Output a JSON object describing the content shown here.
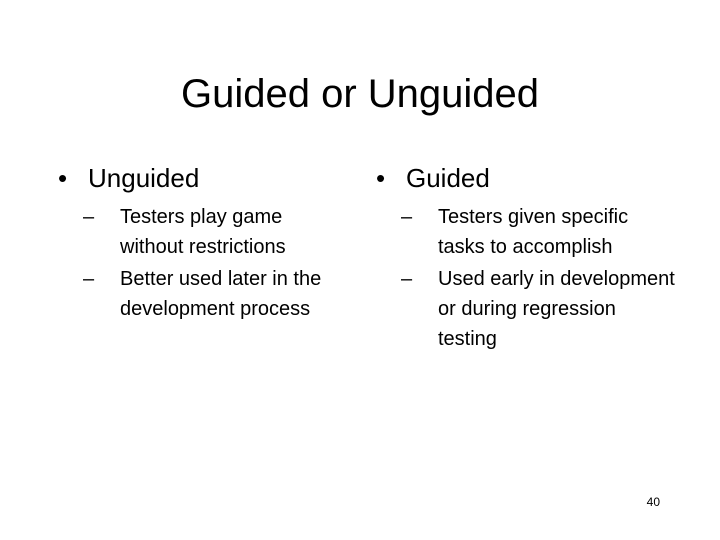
{
  "slide": {
    "title": "Guided or Unguided",
    "columns": [
      {
        "bullet_marker": "•",
        "heading": "Unguided",
        "items": [
          {
            "marker": "–",
            "text": "Testers play game without restrictions"
          },
          {
            "marker": "–",
            "text": "Better used later in the development process"
          }
        ]
      },
      {
        "bullet_marker": "•",
        "heading": "Guided",
        "items": [
          {
            "marker": "–",
            "text": "Testers given specific tasks to accomplish"
          },
          {
            "marker": "–",
            "text": "Used early in development or during regression testing"
          }
        ]
      }
    ],
    "page_number": "40"
  }
}
